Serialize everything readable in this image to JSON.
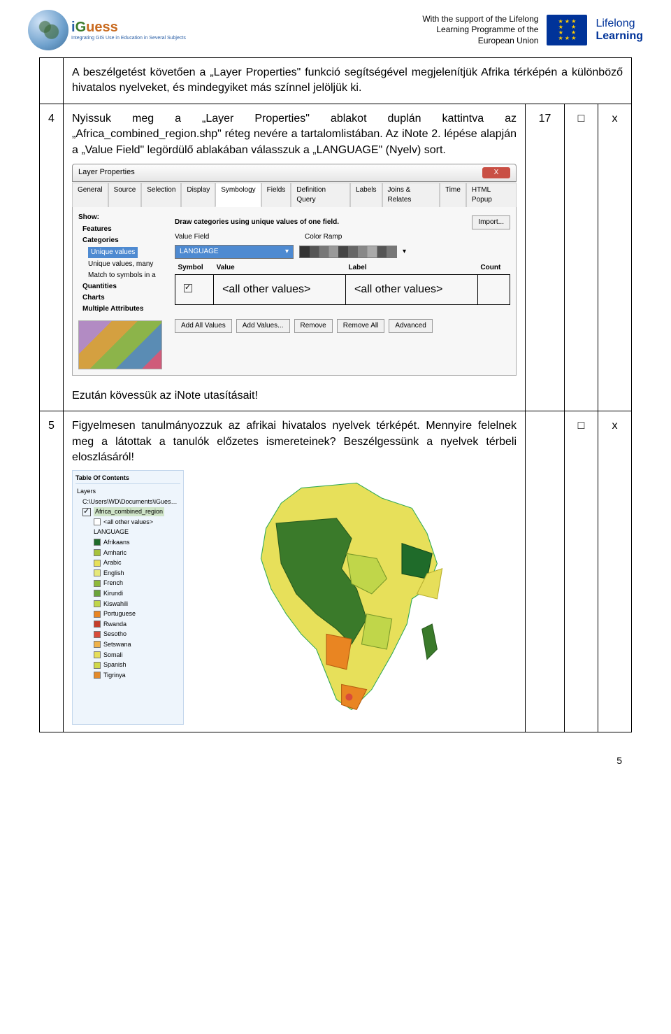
{
  "header": {
    "logo_main": "iGuess",
    "logo_sub": "Integrating GIS Use in Education in Several Subjects",
    "support_l1": "With the support of the Lifelong",
    "support_l2": "Learning Programme of the",
    "support_l3": "European Union",
    "lifelong_top": "Lifelong",
    "lifelong_bot": "Learning"
  },
  "rows": [
    {
      "num": "",
      "text": "A beszélgetést követően a „Layer Properties\" funkció segítségével megjelenítjük Afrika térképén a különböző hivatalos nyelveket, és mindegyiket más színnel jelöljük ki.",
      "time": "",
      "check": "",
      "x": ""
    },
    {
      "num": "4",
      "text": "Nyissuk meg a „Layer Properties\" ablakot duplán kattintva az „Africa_combined_region.shp\" réteg nevére a tartalomlistában. Az iNote 2. lépése alapján a „Value Field\" legördülő ablakában válasszuk a „LANGUAGE\" (Nyelv) sort.",
      "follow": "Ezután kövessük az iNote utasításait!",
      "time": "17",
      "check": "□",
      "x": "x"
    },
    {
      "num": "5",
      "text": "Figyelmesen tanulmányozzuk az afrikai hivatalos nyelvek térképét. Mennyire felelnek meg a látottak a tanulók előzetes ismereteinek? Beszélgessünk a nyelvek térbeli eloszlásáról!",
      "time": "",
      "check": "□",
      "x": "x"
    }
  ],
  "dialog": {
    "title": "Layer Properties",
    "close": "X",
    "tabs": [
      "General",
      "Source",
      "Selection",
      "Display",
      "Symbology",
      "Fields",
      "Definition Query",
      "Labels",
      "Joins & Relates",
      "Time",
      "HTML Popup"
    ],
    "active_tab": "Symbology",
    "show_label": "Show:",
    "show_items": [
      "Features",
      "Categories",
      "Unique values",
      "Unique values, many",
      "Match to symbols in a",
      "Quantities",
      "Charts",
      "Multiple Attributes"
    ],
    "show_selected": "Unique values",
    "desc": "Draw categories using unique values of one field.",
    "import_btn": "Import...",
    "vf_label": "Value Field",
    "vf_value": "LANGUAGE",
    "cr_label": "Color Ramp",
    "sym_hdr": [
      "Symbol",
      "Value",
      "Label",
      "Count"
    ],
    "sym_row": [
      "<all other values>",
      "<all other values>",
      ""
    ],
    "btns": [
      "Add All Values",
      "Add Values...",
      "Remove",
      "Remove All",
      "Advanced"
    ]
  },
  "toc": {
    "title": "Table Of Contents",
    "layers_label": "Layers",
    "path": "C:\\Users\\WD\\Documents\\iGuess\\Data\\iGuess cou",
    "layer": "Africa_combined_region",
    "allother": "<all other values>",
    "field": "LANGUAGE",
    "legend": [
      {
        "c": "#1f6b2a",
        "t": "Afrikaans"
      },
      {
        "c": "#a7c23c",
        "t": "Amharic"
      },
      {
        "c": "#e7e05a",
        "t": "Arabic"
      },
      {
        "c": "#e6e87a",
        "t": "English"
      },
      {
        "c": "#8fb93a",
        "t": "French"
      },
      {
        "c": "#6aa33a",
        "t": "Kirundi"
      },
      {
        "c": "#c0d64a",
        "t": "Kiswahili"
      },
      {
        "c": "#e98522",
        "t": "Portuguese"
      },
      {
        "c": "#c43d2a",
        "t": "Rwanda"
      },
      {
        "c": "#d94c3a",
        "t": "Sesotho"
      },
      {
        "c": "#efb24a",
        "t": "Setswana"
      },
      {
        "c": "#e6de5a",
        "t": "Somali"
      },
      {
        "c": "#d0d84a",
        "t": "Spanish"
      },
      {
        "c": "#e38a2a",
        "t": "Tigrinya"
      }
    ]
  },
  "pagenum": "5"
}
